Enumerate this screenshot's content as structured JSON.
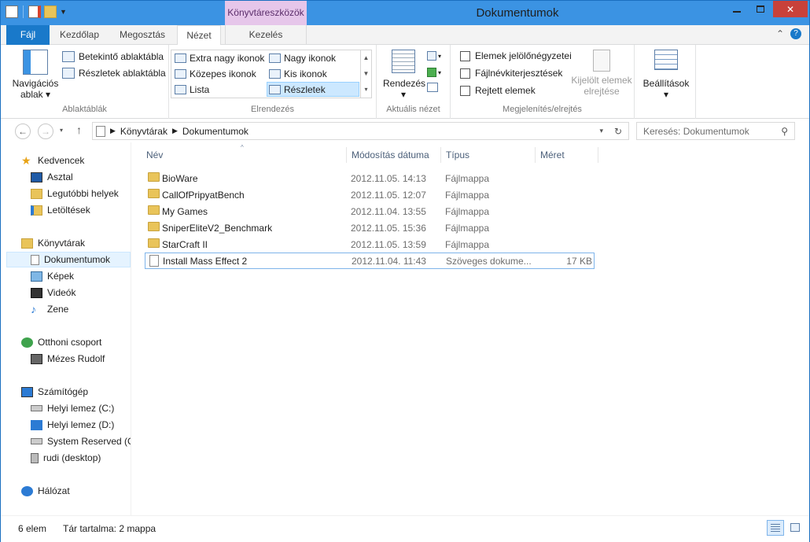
{
  "window": {
    "title": "Dokumentumok",
    "context_tab": "Könyvtáreszközök"
  },
  "tabs": {
    "file": "Fájl",
    "home": "Kezdőlap",
    "share": "Megosztás",
    "view": "Nézet",
    "manage": "Kezelés"
  },
  "ribbon": {
    "panes": {
      "nav_pane_line1": "Navigációs",
      "nav_pane_line2": "ablak",
      "preview": "Betekintő ablaktábla",
      "details": "Részletek ablaktábla",
      "label": "Ablaktáblák"
    },
    "layout": {
      "xl_icons": "Extra nagy ikonok",
      "large_icons": "Nagy ikonok",
      "medium_icons": "Közepes ikonok",
      "small_icons": "Kis ikonok",
      "list": "Lista",
      "details": "Részletek",
      "label": "Elrendezés"
    },
    "current_view": {
      "sort": "Rendezés",
      "label": "Aktuális nézet"
    },
    "show_hide": {
      "checkboxes": "Elemek jelölőnégyzetei",
      "extensions": "Fájlnévkiterjesztések",
      "hidden": "Rejtett elemek",
      "hide_sel_line1": "Kijelölt elemek",
      "hide_sel_line2": "elrejtése",
      "label": "Megjelenítés/elrejtés"
    },
    "options": {
      "label": "Beállítások"
    }
  },
  "address": {
    "crumb1": "Könyvtárak",
    "crumb2": "Dokumentumok",
    "search_placeholder": "Keresés: Dokumentumok"
  },
  "nav": {
    "favorites": "Kedvencek",
    "desktop": "Asztal",
    "recent": "Legutóbbi helyek",
    "downloads": "Letöltések",
    "libraries": "Könyvtárak",
    "documents": "Dokumentumok",
    "pictures": "Képek",
    "videos": "Videók",
    "music": "Zene",
    "homegroup": "Otthoni csoport",
    "user": "Mézes Rudolf",
    "computer": "Számítógép",
    "drive_c": "Helyi lemez (C:)",
    "drive_d": "Helyi lemez (D:)",
    "sysres": "System Reserved (G:",
    "rudi": "rudi (desktop)",
    "network": "Hálózat"
  },
  "columns": {
    "name": "Név",
    "date": "Módosítás dátuma",
    "type": "Típus",
    "size": "Méret"
  },
  "files": [
    {
      "name": "BioWare",
      "date": "2012.11.05. 14:13",
      "type": "Fájlmappa",
      "size": ""
    },
    {
      "name": "CallOfPripyatBench",
      "date": "2012.11.05. 12:07",
      "type": "Fájlmappa",
      "size": ""
    },
    {
      "name": "My Games",
      "date": "2012.11.04. 13:55",
      "type": "Fájlmappa",
      "size": ""
    },
    {
      "name": "SniperEliteV2_Benchmark",
      "date": "2012.11.05. 15:36",
      "type": "Fájlmappa",
      "size": ""
    },
    {
      "name": "StarCraft II",
      "date": "2012.11.05. 13:59",
      "type": "Fájlmappa",
      "size": ""
    },
    {
      "name": "Install Mass Effect 2",
      "date": "2012.11.04. 11:43",
      "type": "Szöveges dokume...",
      "size": "17 KB"
    }
  ],
  "status": {
    "count": "6 elem",
    "library": "Tár tartalma: 2 mappa"
  }
}
